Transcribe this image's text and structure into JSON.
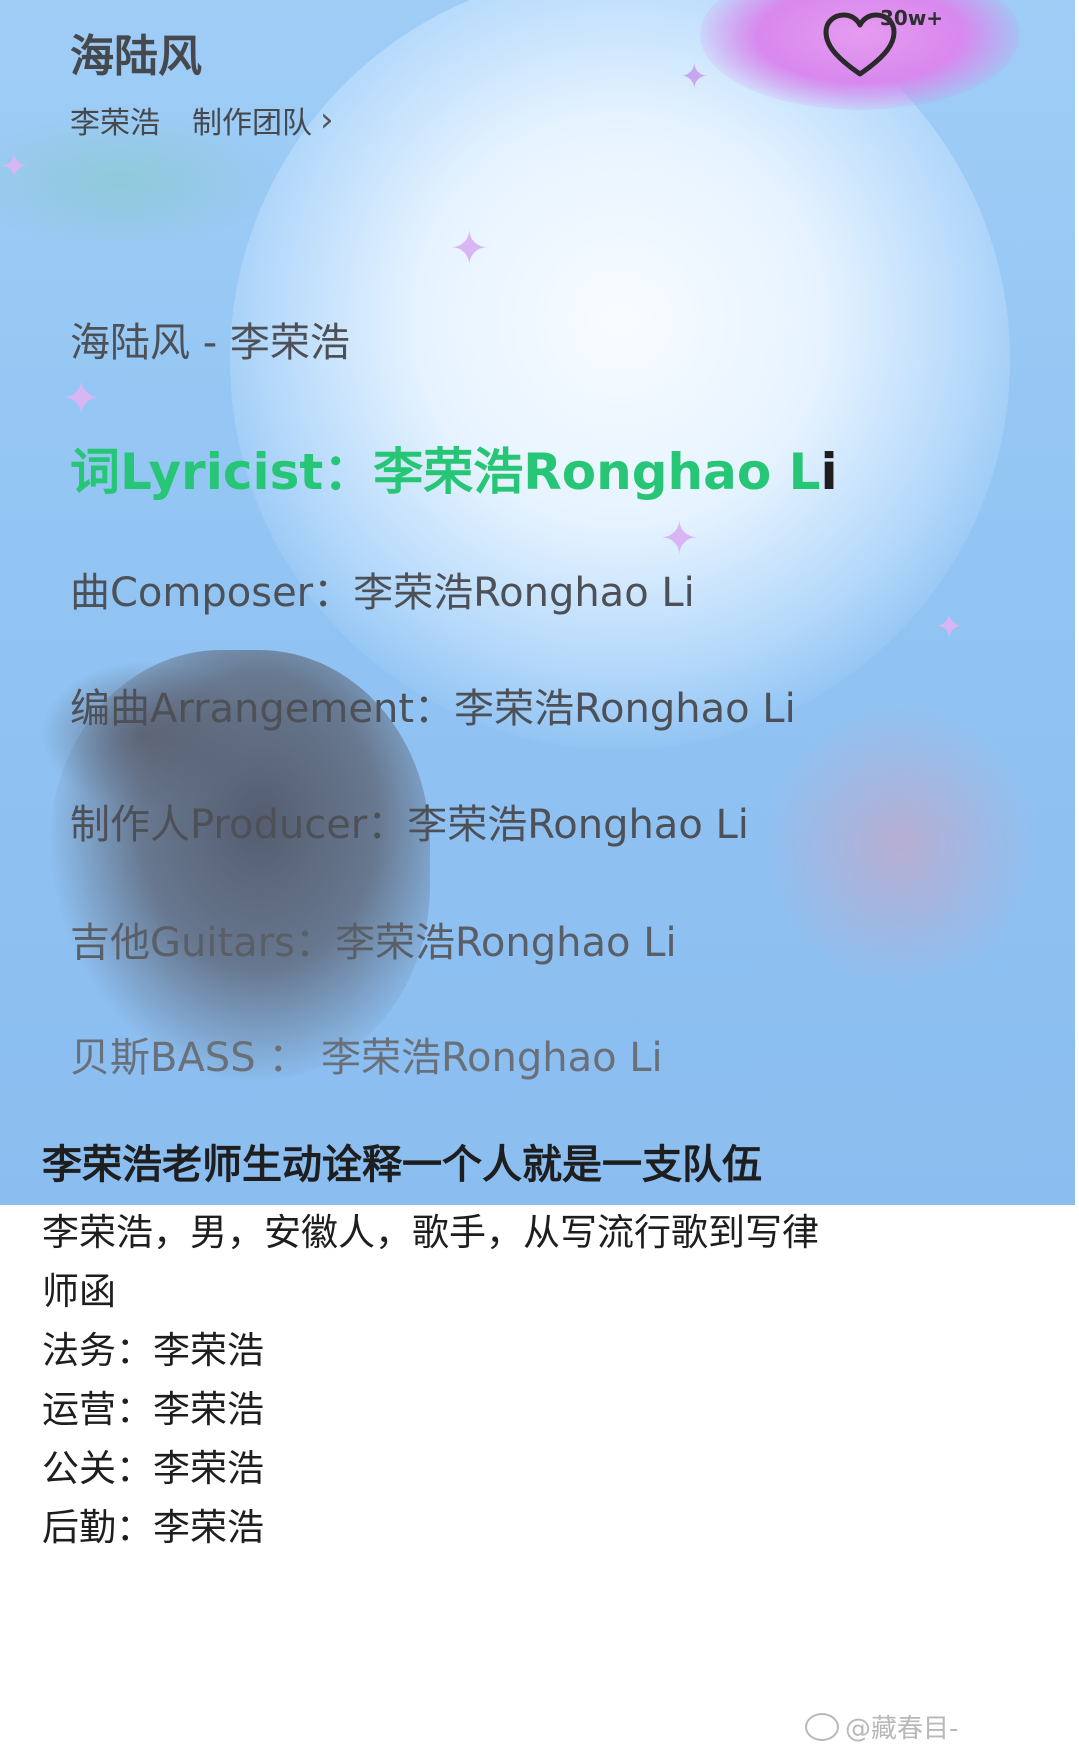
{
  "player": {
    "song_title": "海陆风",
    "artist": "李荣浩",
    "team_link": "制作团队",
    "like_count": "30w+",
    "icons": {
      "like": "heart-icon",
      "team_chevron": "chevron-right-icon"
    }
  },
  "lyrics": [
    {
      "text": "海陆风 - 李荣浩"
    },
    {
      "text": "词Lyricist：李荣浩Ronghao L",
      "tail": "i",
      "active": true
    },
    {
      "text": "曲Composer：李荣浩Ronghao Li"
    },
    {
      "text": "编曲Arrangement：李荣浩Ronghao Li"
    },
    {
      "text": "制作人Producer：李荣浩Ronghao Li"
    },
    {
      "text": "吉他Guitars：李荣浩Ronghao Li"
    },
    {
      "text": "贝斯BASS ： 李荣浩Ronghao Li"
    }
  ],
  "post": {
    "title": "李荣浩老师生动诠释一个人就是一支队伍",
    "body": [
      "李荣浩，男，安徽人，歌手，从写流行歌到写律",
      "师函",
      "法务：李荣浩",
      "运营：李荣浩",
      "公关：李荣浩",
      "后勤：李荣浩"
    ]
  },
  "watermark": "@藏春目-",
  "colors": {
    "active_lyric": "#27c676",
    "lyric": "#4d5157",
    "background": "#9fcdf6"
  }
}
